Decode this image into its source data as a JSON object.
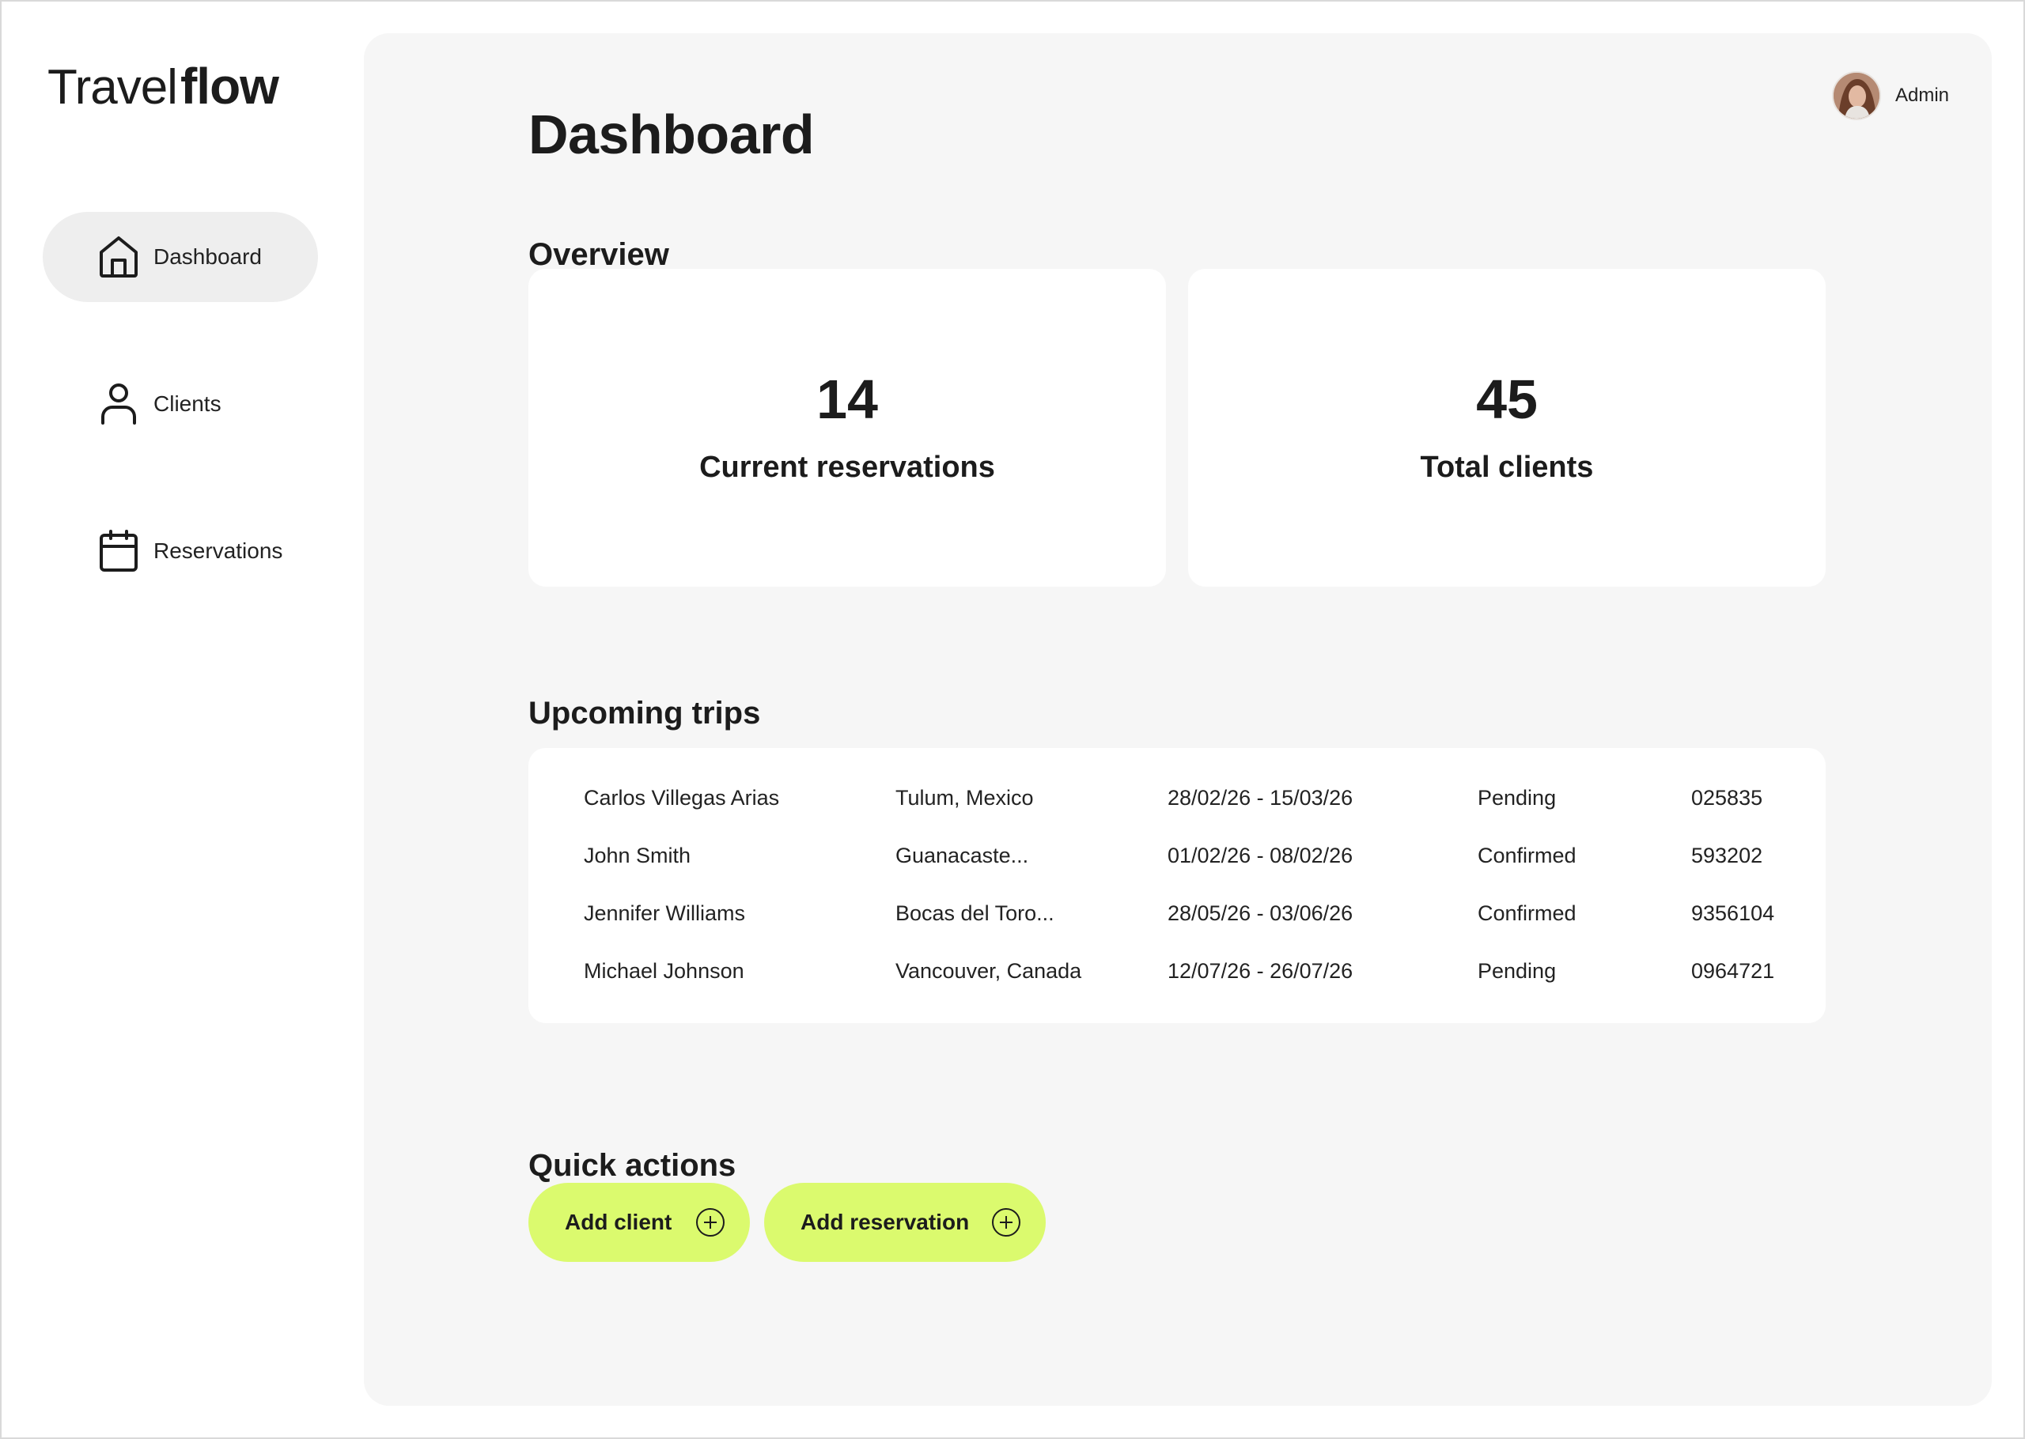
{
  "brand": {
    "light": "Travel",
    "bold": "flow"
  },
  "sidebar": {
    "items": [
      {
        "label": "Dashboard",
        "icon": "home-icon"
      },
      {
        "label": "Clients",
        "icon": "user-icon"
      },
      {
        "label": "Reservations",
        "icon": "calendar-icon"
      }
    ],
    "active": "Dashboard"
  },
  "header": {
    "user_label": "Admin"
  },
  "page": {
    "title": "Dashboard"
  },
  "overview": {
    "title": "Overview",
    "cards": [
      {
        "value": "14",
        "caption": "Current reservations"
      },
      {
        "value": "45",
        "caption": "Total clients"
      }
    ]
  },
  "trips": {
    "title": "Upcoming trips",
    "rows": [
      {
        "name": "Carlos Villegas Arias",
        "destination": "Tulum, Mexico",
        "dates": "28/02/26 - 15/03/26",
        "status": "Pending",
        "code": "025835"
      },
      {
        "name": "John Smith",
        "destination": "Guanacaste...",
        "dates": "01/02/26 - 08/02/26",
        "status": "Confirmed",
        "code": "593202"
      },
      {
        "name": "Jennifer Williams",
        "destination": "Bocas del Toro...",
        "dates": "28/05/26 - 03/06/26",
        "status": "Confirmed",
        "code": "9356104"
      },
      {
        "name": "Michael Johnson",
        "destination": "Vancouver, Canada",
        "dates": "12/07/26 - 26/07/26",
        "status": "Pending",
        "code": "0964721"
      }
    ]
  },
  "quick_actions": {
    "title": "Quick actions",
    "buttons": [
      {
        "label": "Add client",
        "icon": "plus-circle-icon"
      },
      {
        "label": "Add reservation",
        "icon": "plus-circle-icon"
      }
    ]
  },
  "colors": {
    "accent": "#dbfa6e",
    "panel": "#f6f6f6",
    "card": "#ffffff",
    "text": "#1c1c1c"
  }
}
